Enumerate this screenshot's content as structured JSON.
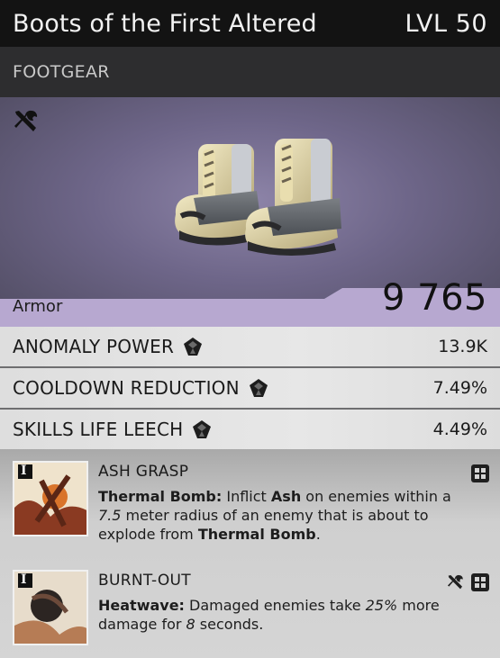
{
  "header": {
    "title": "Boots of the First Altered",
    "level": "LVL 50"
  },
  "subheader": {
    "category": "FOOTGEAR"
  },
  "hero": {
    "icon": "crafting-tools-icon"
  },
  "armor": {
    "label": "Armor",
    "value": "9 765"
  },
  "stats": [
    {
      "name": "ANOMALY POWER",
      "value": "13.9K",
      "icon": "gem-icon"
    },
    {
      "name": "COOLDOWN REDUCTION",
      "value": "7.49%",
      "icon": "gem-icon"
    },
    {
      "name": "SKILLS LIFE LEECH",
      "value": "4.49%",
      "icon": "gem-icon"
    }
  ],
  "mods": [
    {
      "tier": "I",
      "title": "ASH GRASP",
      "desc": {
        "skill": "Thermal Bomb:",
        "t1": " Inflict ",
        "k1": "Ash",
        "t2": " on enemies within a ",
        "n1": "7.5",
        "t3": " meter radius of an enemy that is about to explode from ",
        "k2": "Thermal Bomb",
        "t4": "."
      },
      "icons": [
        "grid-icon"
      ]
    },
    {
      "tier": "I",
      "title": "BURNT-OUT",
      "desc": {
        "skill": "Heatwave:",
        "t1": " Damaged enemies take ",
        "n1": "25%",
        "t2": " more damage for ",
        "n2": "8",
        "t3": " seconds."
      },
      "icons": [
        "crafting-tools-icon",
        "grid-icon"
      ]
    }
  ],
  "colors": {
    "armor_band": "#b7a8d0",
    "header_bg": "#131313",
    "subheader_bg": "#2d2d2f"
  }
}
